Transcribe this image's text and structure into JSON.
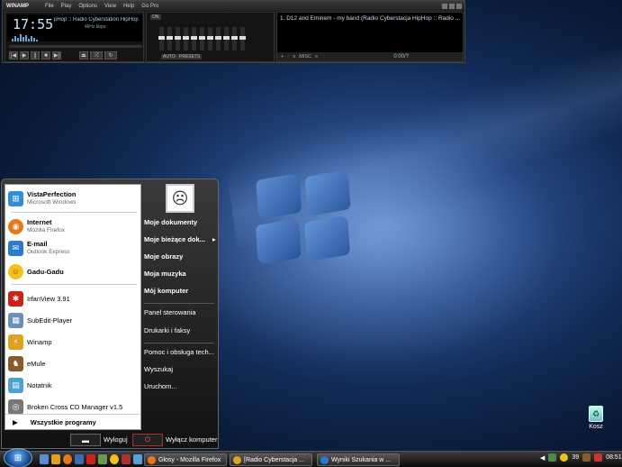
{
  "winamp": {
    "brand": "WINAMP",
    "menu": [
      "File",
      "Play",
      "Options",
      "View",
      "Help",
      "Go Pro"
    ],
    "time": "17:55",
    "song": "pHop :: Radio Cyberstation HipHop :: ",
    "info": "4kHz  kbps  ",
    "eq_on": "ON",
    "eq_auto": "AUTO",
    "eq_presets": "PRESETS",
    "playlist_item": "1. D12 and Eminem - my band (Radio Cyberstacja HipHop :: Radio ...",
    "playlist_time": "0:00/?",
    "pl_buttons": [
      "+",
      "-",
      "≡",
      "MISC",
      "≡"
    ]
  },
  "start_menu": {
    "pinned": [
      {
        "title": "VistaPerfection",
        "sub": "Microsoft Windows",
        "icon": "windows-logo-icon",
        "color": "#2f8fd8"
      },
      {
        "title": "Internet",
        "sub": "Mozilla Firefox",
        "icon": "firefox-icon",
        "color": "#e8771c"
      },
      {
        "title": "E-mail",
        "sub": "Outlook Express",
        "icon": "outlook-express-icon",
        "color": "#2a7bd0"
      },
      {
        "title": "Gadu-Gadu",
        "sub": "",
        "icon": "gadu-gadu-icon",
        "color": "#f2c21a"
      }
    ],
    "recent": [
      {
        "label": "IrfanView 3.91",
        "icon": "irfanview-icon",
        "color": "#d0201a"
      },
      {
        "label": "SubEdit-Player",
        "icon": "subedit-icon",
        "color": "#6a8fb8"
      },
      {
        "label": "Winamp",
        "icon": "winamp-icon",
        "color": "#e0a020"
      },
      {
        "label": "eMule",
        "icon": "emule-icon",
        "color": "#8a5a2a"
      },
      {
        "label": "Notatnik",
        "icon": "notepad-icon",
        "color": "#4aa0d8"
      },
      {
        "label": "Broken Cross CD Manager v1.5",
        "icon": "cd-manager-icon",
        "color": "#777777"
      }
    ],
    "all_programs": "Wszystkie programy",
    "right": [
      "Moje dokumenty",
      "Moje bieżące dok...",
      "Moje obrazy",
      "Moja muzyka",
      "Mój komputer"
    ],
    "right_system": [
      "Panel sterowania",
      "Drukarki i faksy"
    ],
    "right_help": [
      "Pomoc i obsługa tech...",
      "Wyszukaj",
      "Uruchom..."
    ],
    "logoff": "Wyloguj",
    "shutdown": "Wyłącz komputer"
  },
  "desktop": {
    "recycle_bin": "Kosz"
  },
  "taskbar": {
    "buttons": [
      {
        "label": "Głosy - Mozilla Firefox",
        "color": "#e8771c"
      },
      {
        "label": "[Radio Cyberstacja ...",
        "color": "#e0a020"
      },
      {
        "label": "Wyniki Szukania w ...",
        "color": "#2a7bd0"
      }
    ],
    "tray_number": "39",
    "clock": "08:51"
  }
}
